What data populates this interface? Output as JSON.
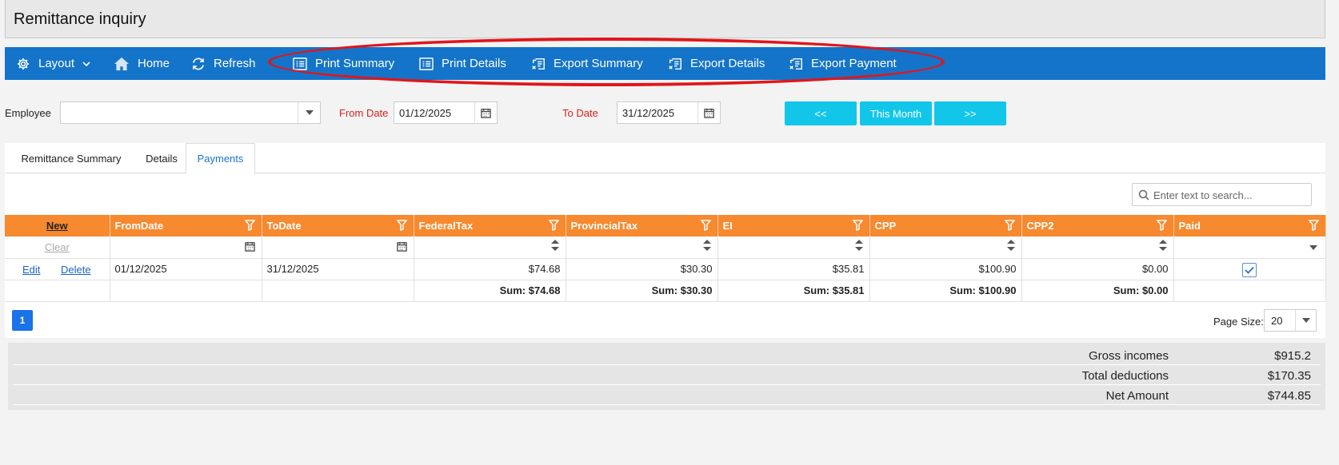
{
  "window": {
    "title": "Remittance inquiry"
  },
  "toolbar": {
    "items": [
      {
        "label": "Layout",
        "icon": "gear-icon"
      },
      {
        "label": "Home",
        "icon": "home-icon"
      },
      {
        "label": "Refresh",
        "icon": "refresh-icon"
      },
      {
        "label": "Print Summary",
        "icon": "print-list-icon"
      },
      {
        "label": "Print Details",
        "icon": "print-list-icon"
      },
      {
        "label": "Export Summary",
        "icon": "export-icon"
      },
      {
        "label": "Export Details",
        "icon": "export-icon"
      },
      {
        "label": "Export Payment",
        "icon": "export-icon"
      }
    ]
  },
  "filters": {
    "employee_label": "Employee",
    "employee_value": "",
    "from_date_label": "From Date",
    "from_date": "01/12/2025",
    "to_date_label": "To Date",
    "to_date": "31/12/2025",
    "prev_label": "<<",
    "this_month_label": "This Month",
    "next_label": ">>"
  },
  "tabs": [
    {
      "label": "Remittance Summary",
      "active": false
    },
    {
      "label": "Details",
      "active": false
    },
    {
      "label": "Payments",
      "active": true
    }
  ],
  "search": {
    "placeholder": "Enter text to search..."
  },
  "grid": {
    "new_label": "New",
    "columns": [
      "FromDate",
      "ToDate",
      "FederalTax",
      "ProvincialTax",
      "EI",
      "CPP",
      "CPP2",
      "Paid"
    ],
    "clear_label": "Clear",
    "rows": [
      {
        "edit_label": "Edit",
        "delete_label": "Delete",
        "from_date": "01/12/2025",
        "to_date": "31/12/2025",
        "federal_tax": "$74.68",
        "provincial_tax": "$30.30",
        "ei": "$35.81",
        "cpp": "$100.90",
        "cpp2": "$0.00",
        "paid": true
      }
    ],
    "sums": {
      "federal_tax": "Sum: $74.68",
      "provincial_tax": "Sum: $30.30",
      "ei": "Sum: $35.81",
      "cpp": "Sum: $100.90",
      "cpp2": "Sum: $0.00"
    }
  },
  "pager": {
    "current_page": "1",
    "page_size_label": "Page Size:",
    "page_size": "20"
  },
  "totals": {
    "gross_incomes_label": "Gross incomes",
    "gross_incomes": "$915.2",
    "total_deductions_label": "Total deductions",
    "total_deductions": "$170.35",
    "net_amount_label": "Net Amount",
    "net_amount": "$744.85"
  },
  "colors": {
    "toolbar": "#1474c9",
    "grid_header": "#f7892f",
    "nav_button": "#12c6ea",
    "highlight_oval": "#e0161b",
    "required_label": "#d5231c"
  }
}
